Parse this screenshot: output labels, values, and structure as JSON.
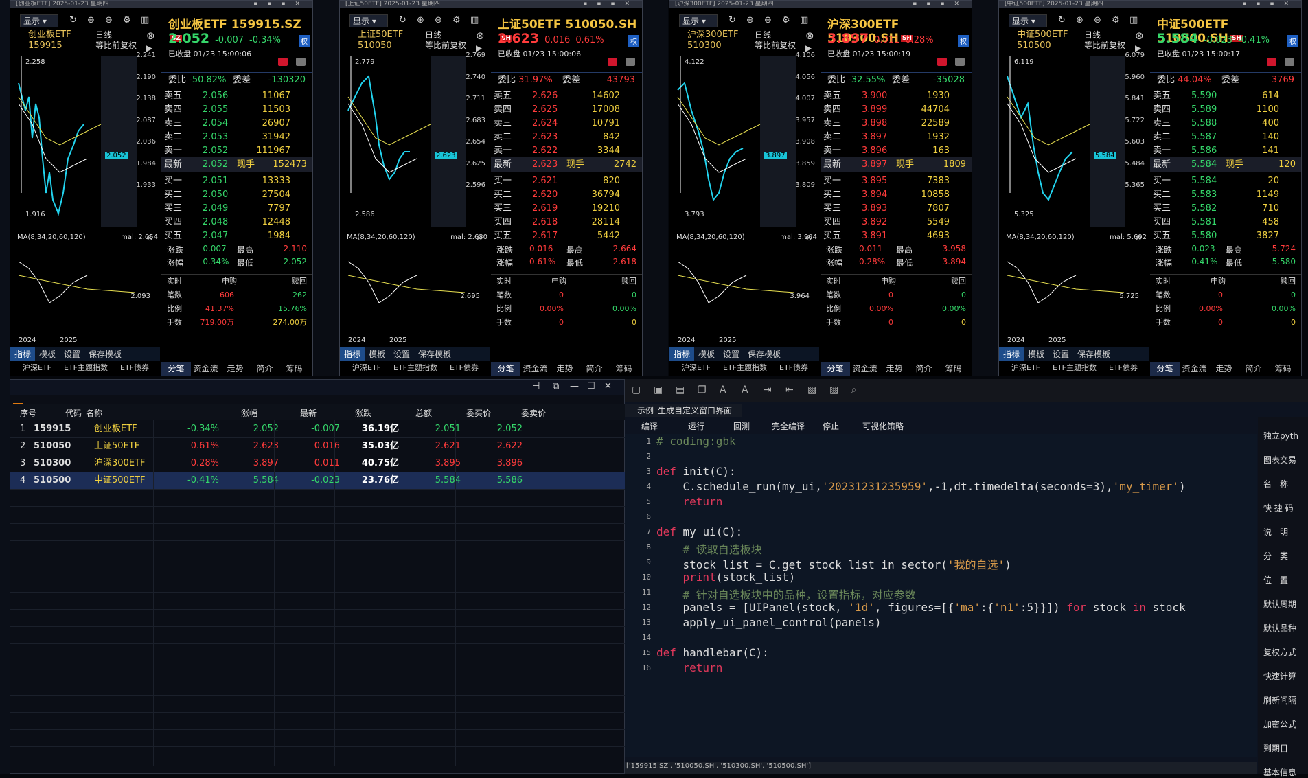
{
  "windows": [
    {
      "title": "[创业板ETF] 2025-01-23 星期四",
      "name": "创业板ETF",
      "code": "159915",
      "header": "创业板ETF  159915.SZ",
      "badge": "SZ",
      "price": "2.052",
      "chg": "-0.007",
      "pct": "-0.34%",
      "pcolor": "#35d66a",
      "date": "已收盘  01/23  15:00:06",
      "weibi_label": "委比",
      "weibi": "-50.82%",
      "weicha_label": "委差",
      "weicha": "-130320",
      "wbcolor": "#35d66a",
      "axis": [
        "2.241",
        "2.190",
        "2.138",
        "2.087",
        "2.036",
        "1.984",
        "1.933"
      ],
      "hi_label": "2.258",
      "lo_label": "1.916",
      "curtag": "2.052",
      "subaxis": "2.093",
      "mal": "mal: 2.054",
      "sell": [
        [
          "卖五",
          "2.056",
          "11067"
        ],
        [
          "卖四",
          "2.055",
          "11503"
        ],
        [
          "卖三",
          "2.054",
          "26907"
        ],
        [
          "卖二",
          "2.053",
          "31942"
        ],
        [
          "卖一",
          "2.052",
          "111967"
        ]
      ],
      "latest": [
        "最新",
        "2.052",
        "现手",
        "152473"
      ],
      "buy": [
        [
          "买一",
          "2.051",
          "13333"
        ],
        [
          "买二",
          "2.050",
          "27504"
        ],
        [
          "买三",
          "2.049",
          "7797"
        ],
        [
          "买四",
          "2.048",
          "12448"
        ],
        [
          "买五",
          "2.047",
          "1984"
        ]
      ],
      "zd": "-0.007",
      "zf": "-0.34%",
      "high": "2.110",
      "low": "2.052",
      "fund": {
        "sg": "申购",
        "sh": "赎回",
        "rows": [
          [
            "实时",
            "",
            ""
          ],
          [
            "笔数",
            "606",
            "262"
          ],
          [
            "比例",
            "41.37%",
            "15.76%"
          ],
          [
            "手数",
            "719.00万",
            "274.00万"
          ]
        ]
      },
      "poly": "10,40 20,80 25,60 30,120 35,70 40,90 45,150 50,200 55,170 60,210 68,230 75,200 82,150 90,130 97,110 105,100"
    },
    {
      "title": "[上证50ETF] 2025-01-23 星期四",
      "name": "上证50ETF",
      "code": "510050",
      "header": "上证50ETF  510050.SH",
      "badge": "SH",
      "price": "2.623",
      "chg": "0.016",
      "pct": "0.61%",
      "pcolor": "#ff3b3b",
      "date": "已收盘  01/23  15:00:06",
      "weibi_label": "委比",
      "weibi": "31.97%",
      "weicha_label": "委差",
      "weicha": "43793",
      "wbcolor": "#ff3b3b",
      "axis": [
        "2.769",
        "2.740",
        "2.711",
        "2.683",
        "2.654",
        "2.625",
        "2.596"
      ],
      "hi_label": "2.779",
      "lo_label": "2.586",
      "curtag": "2.623",
      "subaxis": "2.695",
      "mal": "mal: 2.630",
      "sell": [
        [
          "卖五",
          "2.626",
          "14602"
        ],
        [
          "卖四",
          "2.625",
          "17008"
        ],
        [
          "卖三",
          "2.624",
          "10791"
        ],
        [
          "卖二",
          "2.623",
          "842"
        ],
        [
          "卖一",
          "2.622",
          "3344"
        ]
      ],
      "latest": [
        "最新",
        "2.623",
        "现手",
        "2742"
      ],
      "buy": [
        [
          "买一",
          "2.621",
          "820"
        ],
        [
          "买二",
          "2.620",
          "36794"
        ],
        [
          "买三",
          "2.619",
          "19210"
        ],
        [
          "买四",
          "2.618",
          "28114"
        ],
        [
          "买五",
          "2.617",
          "5442"
        ]
      ],
      "zd": "0.016",
      "zf": "0.61%",
      "high": "2.664",
      "low": "2.618",
      "fund": {
        "sg": "申购",
        "sh": "赎回",
        "rows": [
          [
            "实时",
            "",
            ""
          ],
          [
            "笔数",
            "0",
            "0"
          ],
          [
            "比例",
            "0.00%",
            "0.00%"
          ],
          [
            "手数",
            "0",
            "0"
          ]
        ]
      },
      "poly": "10,80 20,60 30,40 40,30 50,90 55,130 62,160 70,180 78,170 85,150 92,140 100,140"
    },
    {
      "title": "[沪深300ETF] 2025-01-23 星期四",
      "name": "沪深300ETF",
      "code": "510300",
      "header": "沪深300ETF  510300.SH",
      "badge": "SH",
      "price": "3.897",
      "chg": "0.011",
      "pct": "0.28%",
      "pcolor": "#ff3b3b",
      "date": "已收盘  01/23  15:00:19",
      "weibi_label": "委比",
      "weibi": "-32.55%",
      "weicha_label": "委差",
      "weicha": "-35028",
      "wbcolor": "#35d66a",
      "axis": [
        "4.106",
        "4.056",
        "4.007",
        "3.957",
        "3.908",
        "3.859",
        "3.809"
      ],
      "hi_label": "4.122",
      "lo_label": "3.793",
      "curtag": "3.897",
      "subaxis": "3.964",
      "mal": "mal: 3.904",
      "sell": [
        [
          "卖五",
          "3.900",
          "1930"
        ],
        [
          "卖四",
          "3.899",
          "44704"
        ],
        [
          "卖三",
          "3.898",
          "22589"
        ],
        [
          "卖二",
          "3.897",
          "1932"
        ],
        [
          "卖一",
          "3.896",
          "163"
        ]
      ],
      "latest": [
        "最新",
        "3.897",
        "现手",
        "1809"
      ],
      "buy": [
        [
          "买一",
          "3.895",
          "7383"
        ],
        [
          "买二",
          "3.894",
          "10858"
        ],
        [
          "买三",
          "3.893",
          "7807"
        ],
        [
          "买四",
          "3.892",
          "5549"
        ],
        [
          "买五",
          "3.891",
          "4693"
        ]
      ],
      "zd": "0.011",
      "zf": "0.28%",
      "high": "3.958",
      "low": "3.894",
      "fund": {
        "sg": "申购",
        "sh": "赎回",
        "rows": [
          [
            "实时",
            "",
            ""
          ],
          [
            "笔数",
            "0",
            "0"
          ],
          [
            "比例",
            "0.00%",
            "0.00%"
          ],
          [
            "手数",
            "0",
            "0"
          ]
        ]
      },
      "poly": "10,50 20,40 30,80 40,110 48,140 55,180 62,210 70,200 78,170 86,150 95,140 105,135"
    },
    {
      "title": "[中证500ETF] 2025-01-23 星期四",
      "name": "中证500ETF",
      "code": "510500",
      "header": "中证500ETF  510500.SH",
      "badge": "SH",
      "price": "5.584",
      "chg": "-0.023",
      "pct": "-0.41%",
      "pcolor": "#35d66a",
      "date": "已收盘  01/23  15:00:17",
      "weibi_label": "委比",
      "weibi": "44.04%",
      "weicha_label": "委差",
      "weicha": "3769",
      "wbcolor": "#ff3b3b",
      "axis": [
        "6.079",
        "5.960",
        "5.841",
        "5.722",
        "5.603",
        "5.484",
        "5.365"
      ],
      "hi_label": "6.119",
      "lo_label": "5.325",
      "curtag": "5.584",
      "subaxis": "5.725",
      "mal": "mal: 5.602",
      "sell": [
        [
          "卖五",
          "5.590",
          "614"
        ],
        [
          "卖四",
          "5.589",
          "1100"
        ],
        [
          "卖三",
          "5.588",
          "400"
        ],
        [
          "卖二",
          "5.587",
          "140"
        ],
        [
          "卖一",
          "5.586",
          "141"
        ]
      ],
      "latest": [
        "最新",
        "5.584",
        "现手",
        "120"
      ],
      "buy": [
        [
          "买一",
          "5.584",
          "20"
        ],
        [
          "买二",
          "5.583",
          "1149"
        ],
        [
          "买三",
          "5.582",
          "710"
        ],
        [
          "买四",
          "5.581",
          "458"
        ],
        [
          "买五",
          "5.580",
          "3827"
        ]
      ],
      "zd": "-0.023",
      "zf": "-0.41%",
      "high": "5.724",
      "low": "5.580",
      "fund": {
        "sg": "申购",
        "sh": "赎回",
        "rows": [
          [
            "实时",
            "",
            ""
          ],
          [
            "笔数",
            "0",
            "0"
          ],
          [
            "比例",
            "0.00%",
            "0.00%"
          ],
          [
            "手数",
            "0",
            "0"
          ]
        ]
      },
      "poly": "10,30 20,60 30,90 40,70 48,130 55,170 62,200 70,210 78,190 86,170 95,150 105,140"
    }
  ],
  "chart_ui": {
    "display": "显示",
    "period": "日线",
    "fq": "等比前复权",
    "ma": "MA(8,34,20,60,120)",
    "years": [
      "2024",
      "2025"
    ],
    "tabs": [
      "指标",
      "模板",
      "设置",
      "保存模板"
    ],
    "btabs": [
      "沪深ETF",
      "ETF主题指数",
      "ETF债券"
    ],
    "qtabs": [
      "分笔",
      "资金流",
      "走势",
      "简介",
      "筹码"
    ],
    "auth": "权",
    "zd_label": "涨跌",
    "zf_label": "涨幅",
    "high_label": "最高",
    "low_label": "最低"
  },
  "table": {
    "headers": [
      "序号",
      "代码",
      "名称",
      "涨幅",
      "最新",
      "涨跌",
      "总额",
      "委买价",
      "委卖价"
    ],
    "rows": [
      [
        "1",
        "159915",
        "创业板ETF",
        "-0.34%",
        "2.052",
        "-0.007",
        "36.19亿",
        "2.051",
        "2.052"
      ],
      [
        "2",
        "510050",
        "上证50ETF",
        "0.61%",
        "2.623",
        "0.016",
        "35.03亿",
        "2.621",
        "2.622"
      ],
      [
        "3",
        "510300",
        "沪深300ETF",
        "0.28%",
        "3.897",
        "0.011",
        "40.75亿",
        "3.895",
        "3.896"
      ],
      [
        "4",
        "510500",
        "中证500ETF",
        "-0.41%",
        "5.584",
        "-0.023",
        "23.76亿",
        "5.584",
        "5.586"
      ]
    ],
    "colors": [
      "#35d66a",
      "#ff3b3b",
      "#ff3b3b",
      "#35d66a"
    ],
    "badge": "1"
  },
  "editor": {
    "tab": "示例_生成自定义窗口界面",
    "actions": [
      "编译",
      "运行",
      "回测",
      "完全编译",
      "停止",
      "可视化策略"
    ],
    "lines": [
      {
        "n": "1",
        "t": "# coding:gbk"
      },
      {
        "n": "2",
        "t": ""
      },
      {
        "n": "3",
        "t": "def init(C):"
      },
      {
        "n": "4",
        "t": "    C.schedule_run(my_ui,'20231231235959',-1,dt.timedelta(seconds=3),'my_timer')"
      },
      {
        "n": "5",
        "t": "    return"
      },
      {
        "n": "6",
        "t": ""
      },
      {
        "n": "7",
        "t": "def my_ui(C):"
      },
      {
        "n": "8",
        "t": "    # 读取自选板块"
      },
      {
        "n": "9",
        "t": "    stock_list = C.get_stock_list_in_sector('我的自选')"
      },
      {
        "n": "10",
        "t": "    print(stock_list)"
      },
      {
        "n": "11",
        "t": "    # 针对自选板块中的品种，设置指标，对应参数"
      },
      {
        "n": "12",
        "t": "    panels = [UIPanel(stock, '1d', figures=[{'ma':{'n1':5}}]) for stock in stock"
      },
      {
        "n": "13",
        "t": "    apply_ui_panel_control(panels)"
      },
      {
        "n": "14",
        "t": ""
      },
      {
        "n": "15",
        "t": "def handlebar(C):"
      },
      {
        "n": "16",
        "t": "    return"
      }
    ],
    "footer": "['159915.SZ', '510050.SH', '510300.SH', '510500.SH']"
  },
  "right_panel": {
    "items": [
      "独立pyth",
      "图表交易",
      "名　称",
      "快 捷 码",
      "说　明",
      "分　类",
      "位　置",
      "默认周期",
      "默认品种",
      "复权方式",
      "快速计算",
      "刷新间隔",
      "加密公式",
      "到期日",
      "基本信息"
    ]
  }
}
